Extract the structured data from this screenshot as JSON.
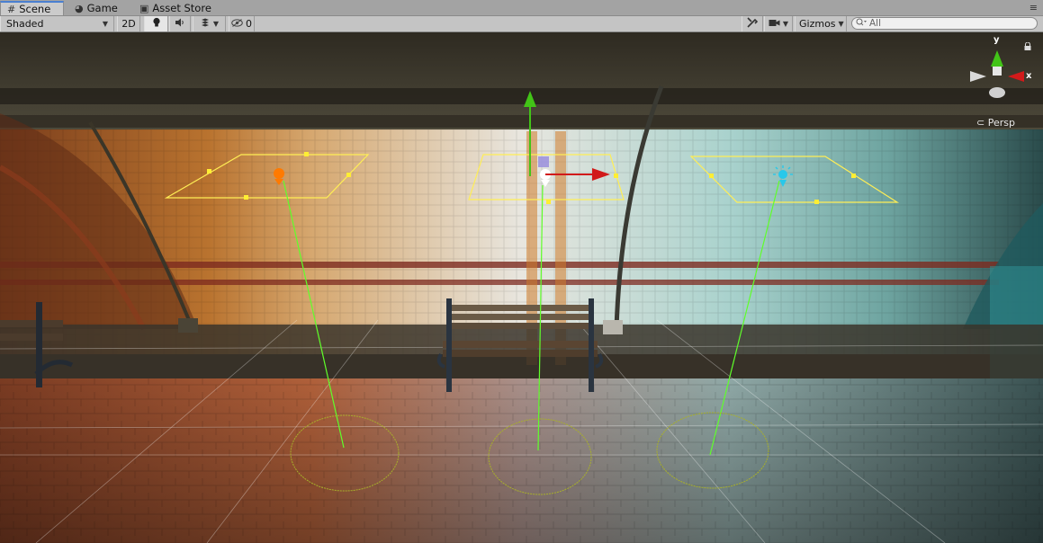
{
  "tabs": [
    {
      "label": "Scene",
      "icon": "grid-icon",
      "active": true
    },
    {
      "label": "Game",
      "icon": "pacman-icon",
      "active": false
    },
    {
      "label": "Asset Store",
      "icon": "bag-icon",
      "active": false
    }
  ],
  "toolbar": {
    "shading_mode": "Shaded",
    "mode_2d": "2D",
    "hidden_count": "0",
    "gizmos_label": "Gizmos",
    "search_placeholder": "All"
  },
  "scene_gizmo": {
    "projection_label": "Persp",
    "axes": {
      "y": "y",
      "x": "x"
    }
  },
  "colors": {
    "accent": "#4a7fd0",
    "light_left": "#ff7a00",
    "light_center": "#ffffff",
    "light_right": "#22c8e8",
    "gizmo_y": "#42c417",
    "gizmo_x": "#d11a1a"
  }
}
